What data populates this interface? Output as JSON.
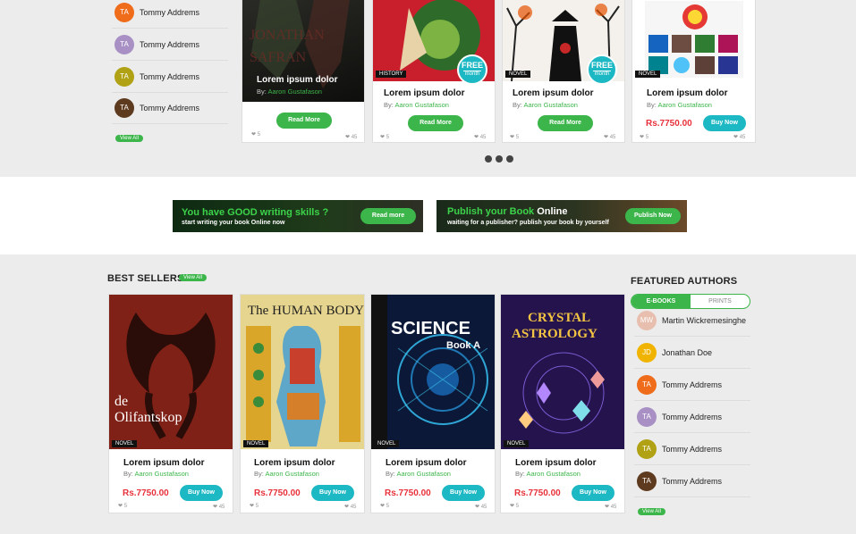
{
  "top_authors": {
    "items": [
      {
        "initials": "TA",
        "name": "Tommy Addrems",
        "color": "#ef6c1b"
      },
      {
        "initials": "TA",
        "name": "Tommy Addrems",
        "color": "#a890c4"
      },
      {
        "initials": "TA",
        "name": "Tommy Addrems",
        "color": "#b0a214"
      },
      {
        "initials": "TA",
        "name": "Tommy Addrems",
        "color": "#5e3a1e"
      }
    ],
    "view_all": "View All"
  },
  "top_books": [
    {
      "title": "Lorem ipsum dolor",
      "by": "By:",
      "author": "Aaron Gustafason",
      "action": "Read More",
      "likes": "5",
      "views": "45",
      "tag": "",
      "free": ""
    },
    {
      "title": "Lorem ipsum dolor",
      "by": "By:",
      "author": "Aaron Gustafason",
      "action": "Read More",
      "likes": "5",
      "views": "45",
      "tag": "HISTORY",
      "free_top": "FREE",
      "free_bottom": "month"
    },
    {
      "title": "Lorem ipsum dolor",
      "by": "By:",
      "author": "Aaron Gustafason",
      "action": "Read More",
      "likes": "5",
      "views": "45",
      "tag": "NOVEL",
      "free_top": "FREE",
      "free_bottom": "month"
    },
    {
      "title": "Lorem ipsum dolor",
      "by": "By:",
      "author": "Aaron Gustafason",
      "action": "Buy Now",
      "price": "Rs.7750.00",
      "likes": "5",
      "views": "45",
      "tag": "NOVEL"
    }
  ],
  "banners": {
    "left": {
      "headline": "You have GOOD writing skills ?",
      "sub": "start writing your book Online now",
      "button": "Read more"
    },
    "right": {
      "headline_a": "Publish your Book",
      "headline_b": " Online",
      "sub": "waiting for a publisher? publish your book by yourself",
      "button": "Publish Now"
    }
  },
  "best_sellers": {
    "heading": "BEST SELLERS",
    "view_all": "View All",
    "books": [
      {
        "title": "Lorem ipsum dolor",
        "by": "By:",
        "author": "Aaron Gustafason",
        "price": "Rs.7750.00",
        "action": "Buy Now",
        "tag": "NOVEL",
        "likes": "5",
        "views": "45",
        "cover_text": "de Olifantskop"
      },
      {
        "title": "Lorem ipsum dolor",
        "by": "By:",
        "author": "Aaron Gustafason",
        "price": "Rs.7750.00",
        "action": "Buy Now",
        "tag": "NOVEL",
        "likes": "5",
        "views": "45",
        "cover_text": "The HUMAN BODY"
      },
      {
        "title": "Lorem ipsum dolor",
        "by": "By:",
        "author": "Aaron Gustafason",
        "price": "Rs.7750.00",
        "action": "Buy Now",
        "tag": "NOVEL",
        "likes": "5",
        "views": "45",
        "cover_text": "SCIENCE"
      },
      {
        "title": "Lorem ipsum dolor",
        "by": "By:",
        "author": "Aaron Gustafason",
        "price": "Rs.7750.00",
        "action": "Buy Now",
        "tag": "NOVEL",
        "likes": "5",
        "views": "45",
        "cover_text": "CRYSTAL ASTROLOGY"
      }
    ]
  },
  "featured_authors": {
    "heading": "FEATURED AUTHORS",
    "tabs": [
      "E-BOOKS",
      "PRINTS"
    ],
    "items": [
      {
        "initials": "MW",
        "name": "Martin Wickremesinghe",
        "color": "#e8bfae"
      },
      {
        "initials": "JD",
        "name": "Jonathan Doe",
        "color": "#f0b400"
      },
      {
        "initials": "TA",
        "name": "Tommy Addrems",
        "color": "#ef6c1b"
      },
      {
        "initials": "TA",
        "name": "Tommy Addrems",
        "color": "#a890c4"
      },
      {
        "initials": "TA",
        "name": "Tommy Addrems",
        "color": "#b0a214"
      },
      {
        "initials": "TA",
        "name": "Tommy Addrems",
        "color": "#5e3a1e"
      }
    ],
    "view_all": "View All"
  }
}
